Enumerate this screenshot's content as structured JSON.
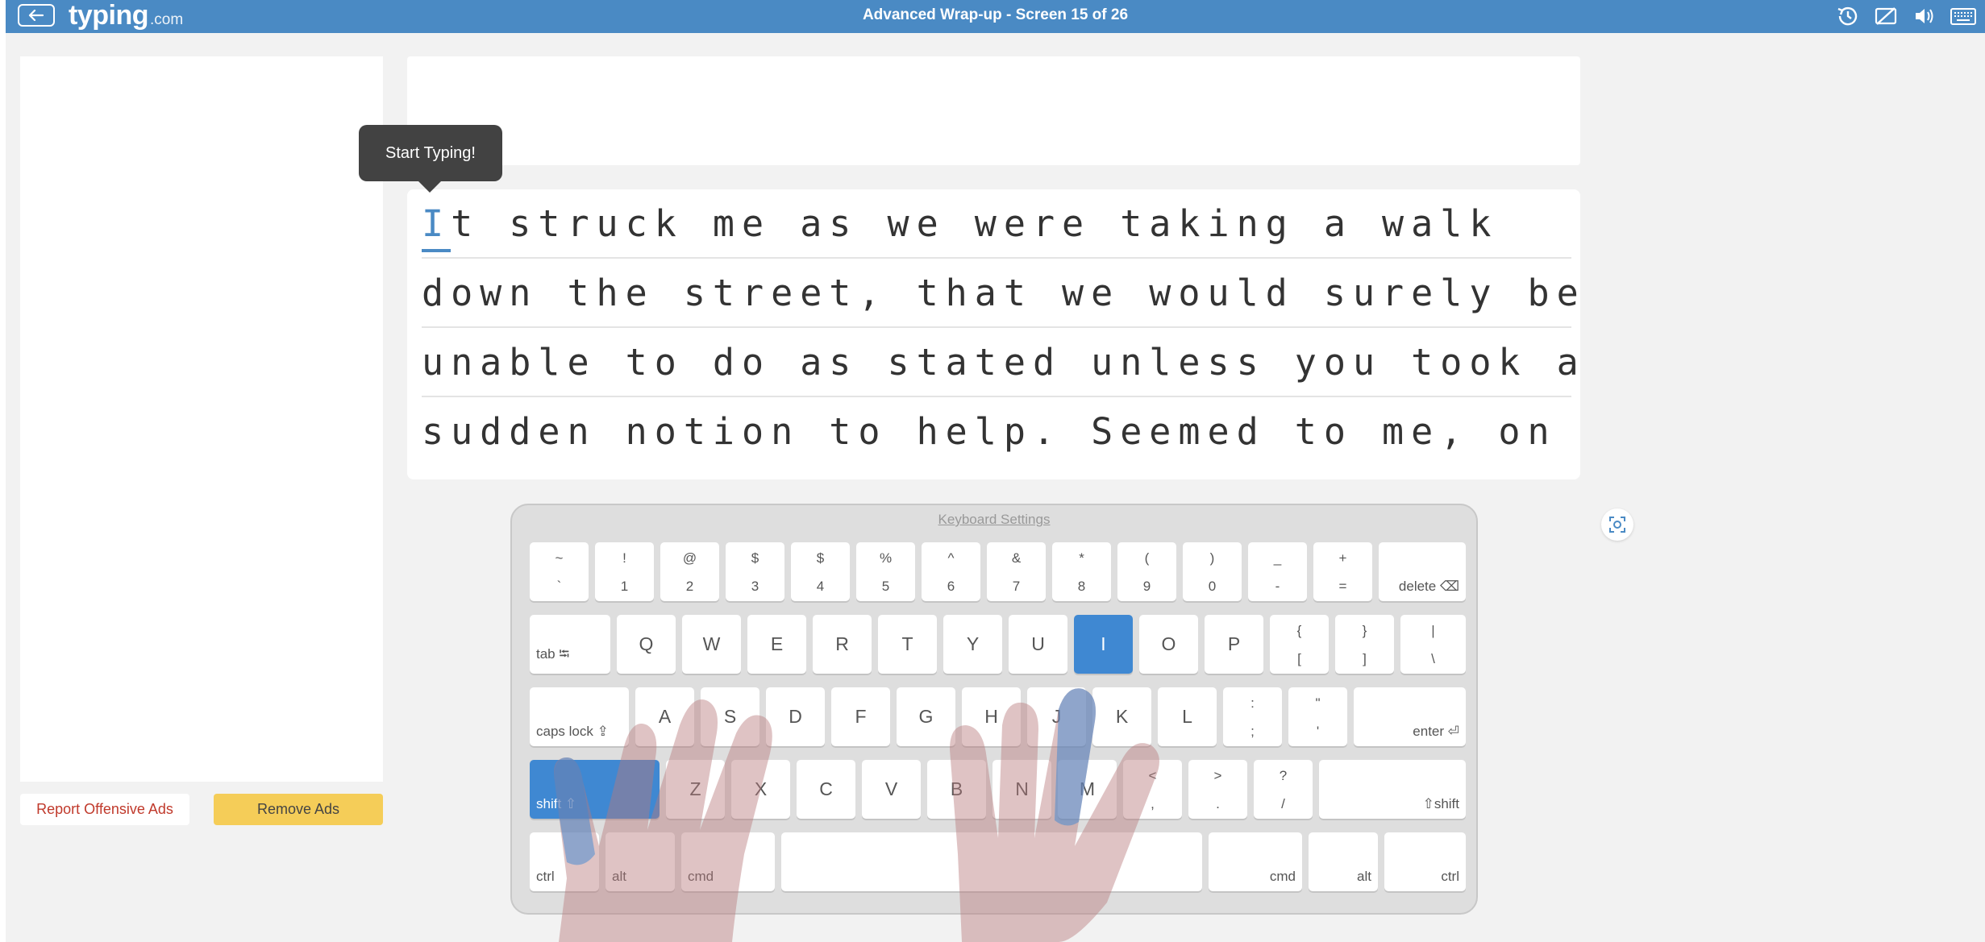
{
  "header": {
    "logo_main": "typing",
    "logo_suffix": ".com",
    "title": "Advanced Wrap-up - Screen 15 of 26",
    "icons": [
      "history-icon",
      "hide-hands-icon",
      "volume-icon",
      "keyboard-icon"
    ]
  },
  "ads": {
    "report_label": "Report Offensive Ads",
    "remove_label": "Remove Ads"
  },
  "tooltip": "Start Typing!",
  "lesson": {
    "current_char": "I",
    "lines": [
      "t struck me as we were taking a walk",
      "down the street, that we would surely be",
      "unable to do as stated unless you took a",
      "sudden notion to help. Seemed to me, on"
    ]
  },
  "keyboard": {
    "settings_label": "Keyboard Settings",
    "row1": [
      {
        "u": "~",
        "l": "`"
      },
      {
        "u": "!",
        "l": "1"
      },
      {
        "u": "@",
        "l": "2"
      },
      {
        "u": "$",
        "l": "3"
      },
      {
        "u": "$",
        "l": "4"
      },
      {
        "u": "%",
        "l": "5"
      },
      {
        "u": "^",
        "l": "6"
      },
      {
        "u": "&",
        "l": "7"
      },
      {
        "u": "*",
        "l": "8"
      },
      {
        "u": "(",
        "l": "9"
      },
      {
        "u": ")",
        "l": "0"
      },
      {
        "u": "_",
        "l": "-"
      },
      {
        "u": "+",
        "l": "="
      }
    ],
    "delete_label": "delete ⌫",
    "tab_label": "tab ⭾",
    "row2": [
      "Q",
      "W",
      "E",
      "R",
      "T",
      "Y",
      "U",
      "I",
      "O",
      "P"
    ],
    "row2_sym": [
      {
        "u": "{",
        "l": "["
      },
      {
        "u": "}",
        "l": "]"
      },
      {
        "u": "|",
        "l": "\\"
      }
    ],
    "caps_label": "caps lock ⇪",
    "row3": [
      "A",
      "S",
      "D",
      "F",
      "G",
      "H",
      "J",
      "K",
      "L"
    ],
    "row3_sym": [
      {
        "u": ":",
        "l": ";"
      },
      {
        "u": "\"",
        "l": "'"
      }
    ],
    "enter_label": "enter ⏎",
    "shift_left_label": "shift ⇧",
    "row4": [
      "Z",
      "X",
      "C",
      "V",
      "B",
      "N",
      "M"
    ],
    "row4_sym": [
      {
        "u": "<",
        "l": ","
      },
      {
        "u": ">",
        "l": "."
      },
      {
        "u": "?",
        "l": "/"
      }
    ],
    "shift_right_label": "⇧shift",
    "ctrl_label": "ctrl",
    "alt_label": "alt",
    "cmd_label": "cmd",
    "highlighted_keys": [
      "I",
      "shift-left"
    ],
    "highlight_color": "#3f88d2"
  }
}
